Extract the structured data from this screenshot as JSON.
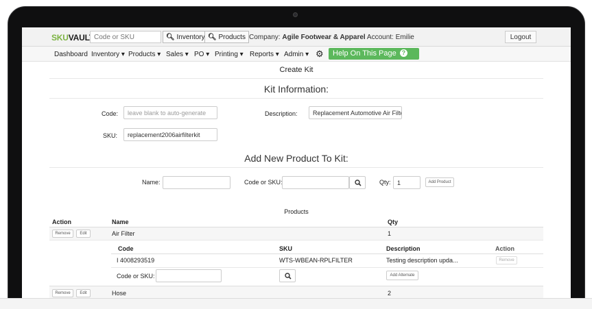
{
  "topbar": {
    "logo_sku": "SKU",
    "logo_vault": "VAULT",
    "search_placeholder": "Code or SKU",
    "inventory_btn": "Inventory",
    "products_btn": "Products",
    "company_label": "Company:",
    "company_name": "Agile Footwear & Apparel",
    "account_label": "Account:",
    "account_name": "Emilie",
    "logout": "Logout"
  },
  "nav": {
    "items": [
      "Dashboard",
      "Inventory ▾",
      "Products ▾",
      "Sales ▾",
      "PO ▾",
      "Printing ▾",
      "Reports ▾",
      "Admin ▾"
    ],
    "help": "Help On This Page",
    "help_icon": "?"
  },
  "page": {
    "title": "Create Kit",
    "kit_info_heading": "Kit Information:",
    "code_label": "Code:",
    "code_placeholder": "leave blank to auto-generate",
    "description_label": "Description:",
    "description_value": "Replacement Automotive Air Filte",
    "sku_label": "SKU:",
    "sku_value": "replacement2006airfilterkit",
    "add_heading": "Add New Product To Kit:",
    "name_label": "Name:",
    "code_sku_label": "Code or SKU:",
    "qty_label": "Qty:",
    "qty_value": "1",
    "add_product_btn": "Add Product"
  },
  "products": {
    "caption": "Products",
    "headers": {
      "action": "Action",
      "name": "Name",
      "qty": "Qty"
    },
    "remove_btn": "Remove",
    "edit_btn": "Edit",
    "rows": [
      {
        "name": "Air Filter",
        "qty": "1"
      },
      {
        "name": "Hose",
        "qty": "2"
      }
    ],
    "sub_headers": {
      "code": "Code",
      "sku": "SKU",
      "description": "Description",
      "action": "Action"
    },
    "sub_row": {
      "marker": "I",
      "code": "4008293519",
      "sku": "WTS-WBEAN-RPLFILTER",
      "description": "Testing description upda...",
      "remove": "Remove"
    },
    "alt_code_label": "Code or SKU:",
    "add_alternate_btn": "Add Alternate"
  }
}
